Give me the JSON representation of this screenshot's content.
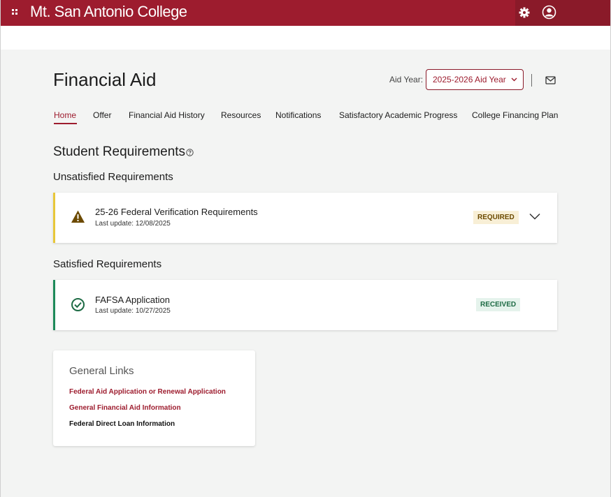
{
  "app": {
    "brand": "Mt. San Antonio College"
  },
  "header": {
    "title": "Financial Aid",
    "aid_year_label": "Aid Year:",
    "aid_year_value": "2025-2026 Aid Year"
  },
  "tabs": [
    {
      "label": "Home",
      "active": true
    },
    {
      "label": "Offer"
    },
    {
      "label": "Financial Aid History"
    },
    {
      "label": "Resources"
    },
    {
      "label": "Notifications"
    },
    {
      "label": "Satisfactory Academic Progress"
    },
    {
      "label": "College Financing Plan"
    }
  ],
  "requirements": {
    "title": "Student Requirements",
    "unsatisfied_label": "Unsatisfied Requirements",
    "satisfied_label": "Satisfied Requirements",
    "unsatisfied": [
      {
        "name": "25-26 Federal Verification Requirements",
        "updated": "Last update: 12/08/2025",
        "status": "REQUIRED"
      }
    ],
    "satisfied": [
      {
        "name": "FAFSA Application",
        "updated": "Last update: 10/27/2025",
        "status": "RECEIVED"
      }
    ]
  },
  "general_links": {
    "title": "General Links",
    "links": [
      {
        "label": "Federal Aid Application or Renewal Application"
      },
      {
        "label": "General Financial Aid Information"
      },
      {
        "label": "Federal Direct Loan Information"
      }
    ]
  },
  "colors": {
    "brand": "#9d1c2e",
    "warning_accent": "#e8c73a",
    "success_accent": "#1d8a5a",
    "background": "#f3f4f3"
  },
  "icons": {
    "app_launcher": "grid-icon",
    "settings": "gear-icon",
    "account": "user-icon",
    "messages": "mail-icon",
    "help": "help-icon",
    "warning": "warning-icon",
    "success": "check-circle-icon",
    "expand": "chevron-down-icon"
  }
}
